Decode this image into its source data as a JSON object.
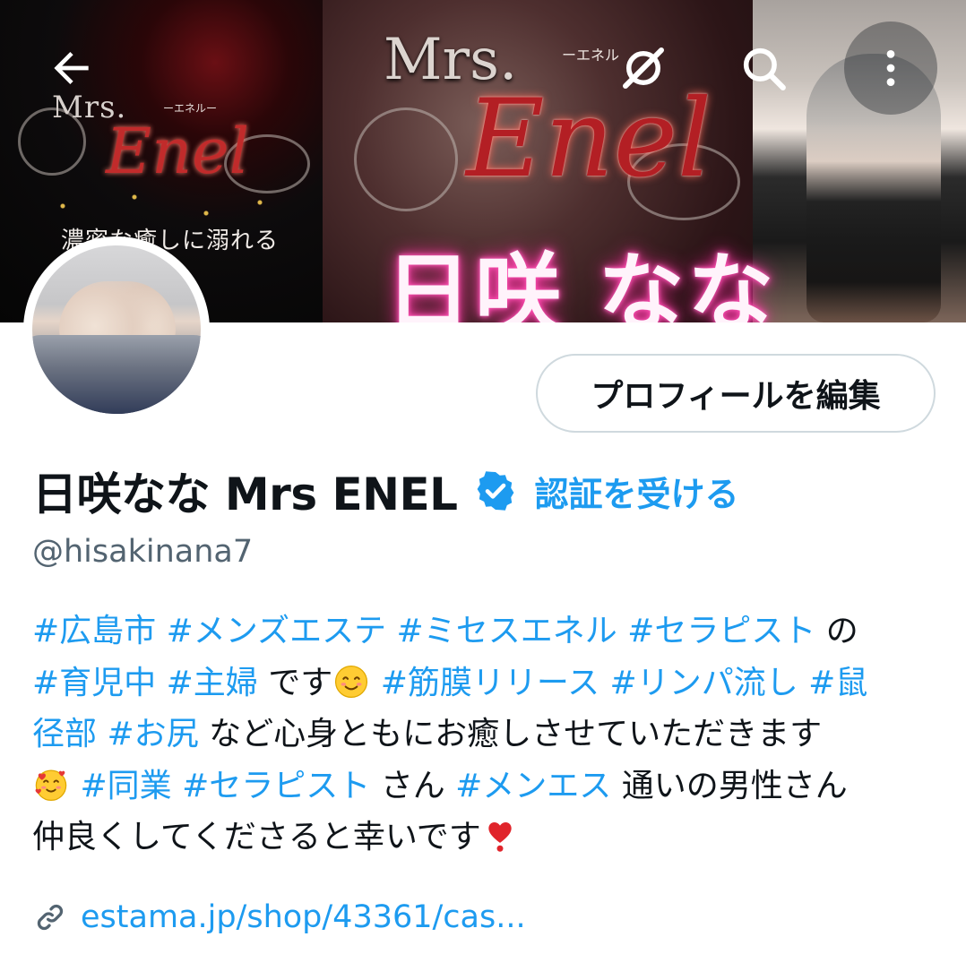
{
  "header": {
    "back_icon": "arrow-left-icon",
    "hidden_icon": "eye-slash-icon",
    "search_icon": "search-icon",
    "more_icon": "more-vertical-icon"
  },
  "banner": {
    "left_logo_top": "Mrs.",
    "left_logo_script": "Enel",
    "left_logo_kana": "ーエネルー",
    "left_tagline": "濃密な癒しに溺れる",
    "main_logo_top": "Mrs.",
    "main_logo_script": "Enel",
    "main_logo_kana": "ーエネル",
    "main_name": "日咲 なな"
  },
  "profile": {
    "edit_button_label": "プロフィールを編集",
    "display_name": "日咲なな Mrs ENEL",
    "get_verified_label": "認証を受ける",
    "handle": "@hisakinana7",
    "verified_color": "#1d9bf0"
  },
  "bio": {
    "line1": [
      {
        "text": "#広島市",
        "tag": true
      },
      {
        "text": " ",
        "tag": false
      },
      {
        "text": "#メンズエステ",
        "tag": true
      },
      {
        "text": " ",
        "tag": false
      },
      {
        "text": "#ミセスエネル",
        "tag": true
      },
      {
        "text": " ",
        "tag": false
      },
      {
        "text": "#セラピスト",
        "tag": true
      },
      {
        "text": " の",
        "tag": false
      }
    ],
    "line2": [
      {
        "text": "#育児中",
        "tag": true
      },
      {
        "text": " ",
        "tag": false
      },
      {
        "text": "#主婦",
        "tag": true
      },
      {
        "text": " です",
        "tag": false
      },
      {
        "emoji": "smiling-face-emoji"
      },
      {
        "text": " ",
        "tag": false
      },
      {
        "text": "#筋膜リリース",
        "tag": true
      },
      {
        "text": " ",
        "tag": false
      },
      {
        "text": "#リンパ流し",
        "tag": true
      },
      {
        "text": " ",
        "tag": false
      },
      {
        "text": "#鼠",
        "tag": true
      }
    ],
    "line3": [
      {
        "text": "径部",
        "tag": true
      },
      {
        "text": " ",
        "tag": false
      },
      {
        "text": "#お尻",
        "tag": true
      },
      {
        "text": " など心身ともにお癒しさせていただきます",
        "tag": false
      }
    ],
    "line4": [
      {
        "emoji": "smiling-face-with-hearts-emoji"
      },
      {
        "text": " ",
        "tag": false
      },
      {
        "text": "#同業",
        "tag": true
      },
      {
        "text": " ",
        "tag": false
      },
      {
        "text": "#セラピスト",
        "tag": true
      },
      {
        "text": " さん ",
        "tag": false
      },
      {
        "text": "#メンエス",
        "tag": true
      },
      {
        "text": " 通いの男性さん",
        "tag": false
      }
    ],
    "line5": [
      {
        "text": "仲良くしてくださると幸いです",
        "tag": false
      },
      {
        "emoji": "heart-exclamation-emoji"
      }
    ]
  },
  "link": {
    "icon": "link-icon",
    "text": "estama.jp/shop/43361/cas..."
  }
}
